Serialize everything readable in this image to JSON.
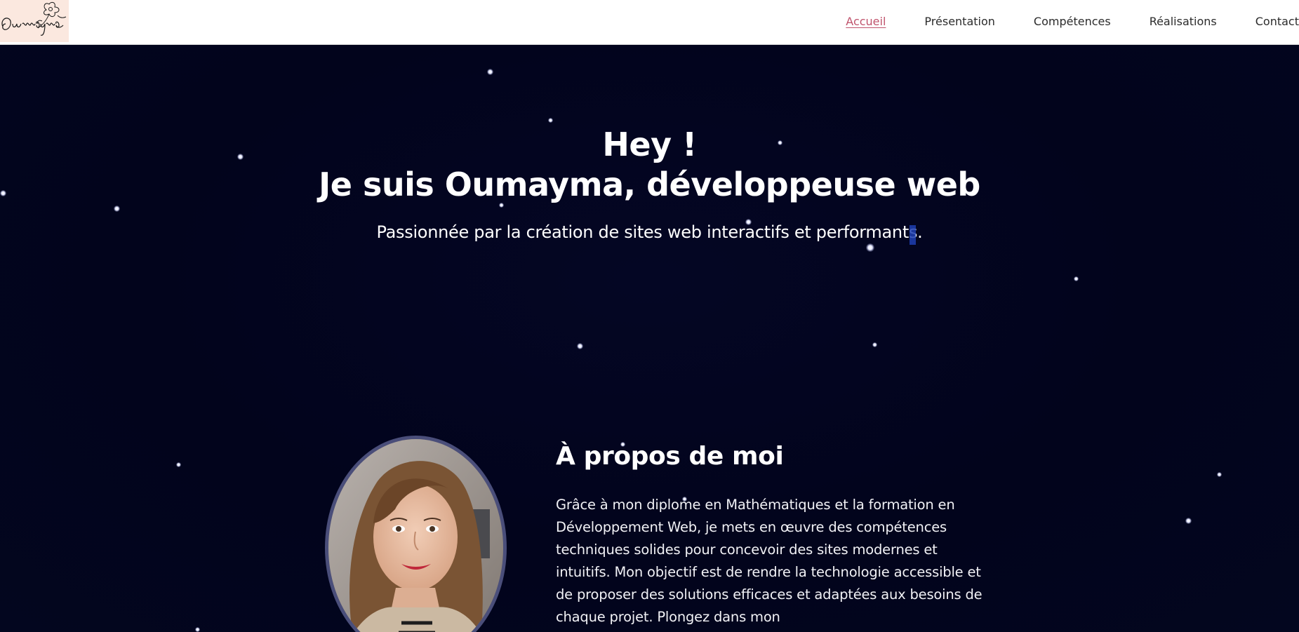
{
  "header": {
    "logo": {
      "text": "Oumayma",
      "icon": "flower-signature-logo"
    },
    "nav": [
      {
        "label": "Accueil",
        "active": true
      },
      {
        "label": "Présentation",
        "active": false
      },
      {
        "label": "Compétences",
        "active": false
      },
      {
        "label": "Réalisations",
        "active": false
      },
      {
        "label": "Contact",
        "active": false
      }
    ]
  },
  "hero": {
    "title_line1": "Hey !",
    "title_line2": "Je suis Oumayma, développeuse web",
    "subtitle": "Passionnée par la création de sites web interactifs et performants."
  },
  "about": {
    "title": "À propos de moi",
    "text": "Grâce à mon diplome en Mathématiques et la formation en Développement Web, je mets en œuvre des compétences techniques solides pour concevoir des sites modernes et intuitifs. Mon objectif est de rendre la technologie accessible et de proposer des solutions efficaces et adaptées aux besoins de chaque projet. Plongez dans mon",
    "photo": "profile-photo"
  },
  "colors": {
    "background": "#02041c",
    "nav_active": "#c0546d",
    "header_bg": "#ffffff",
    "logo_bg": "#fbe8df"
  }
}
